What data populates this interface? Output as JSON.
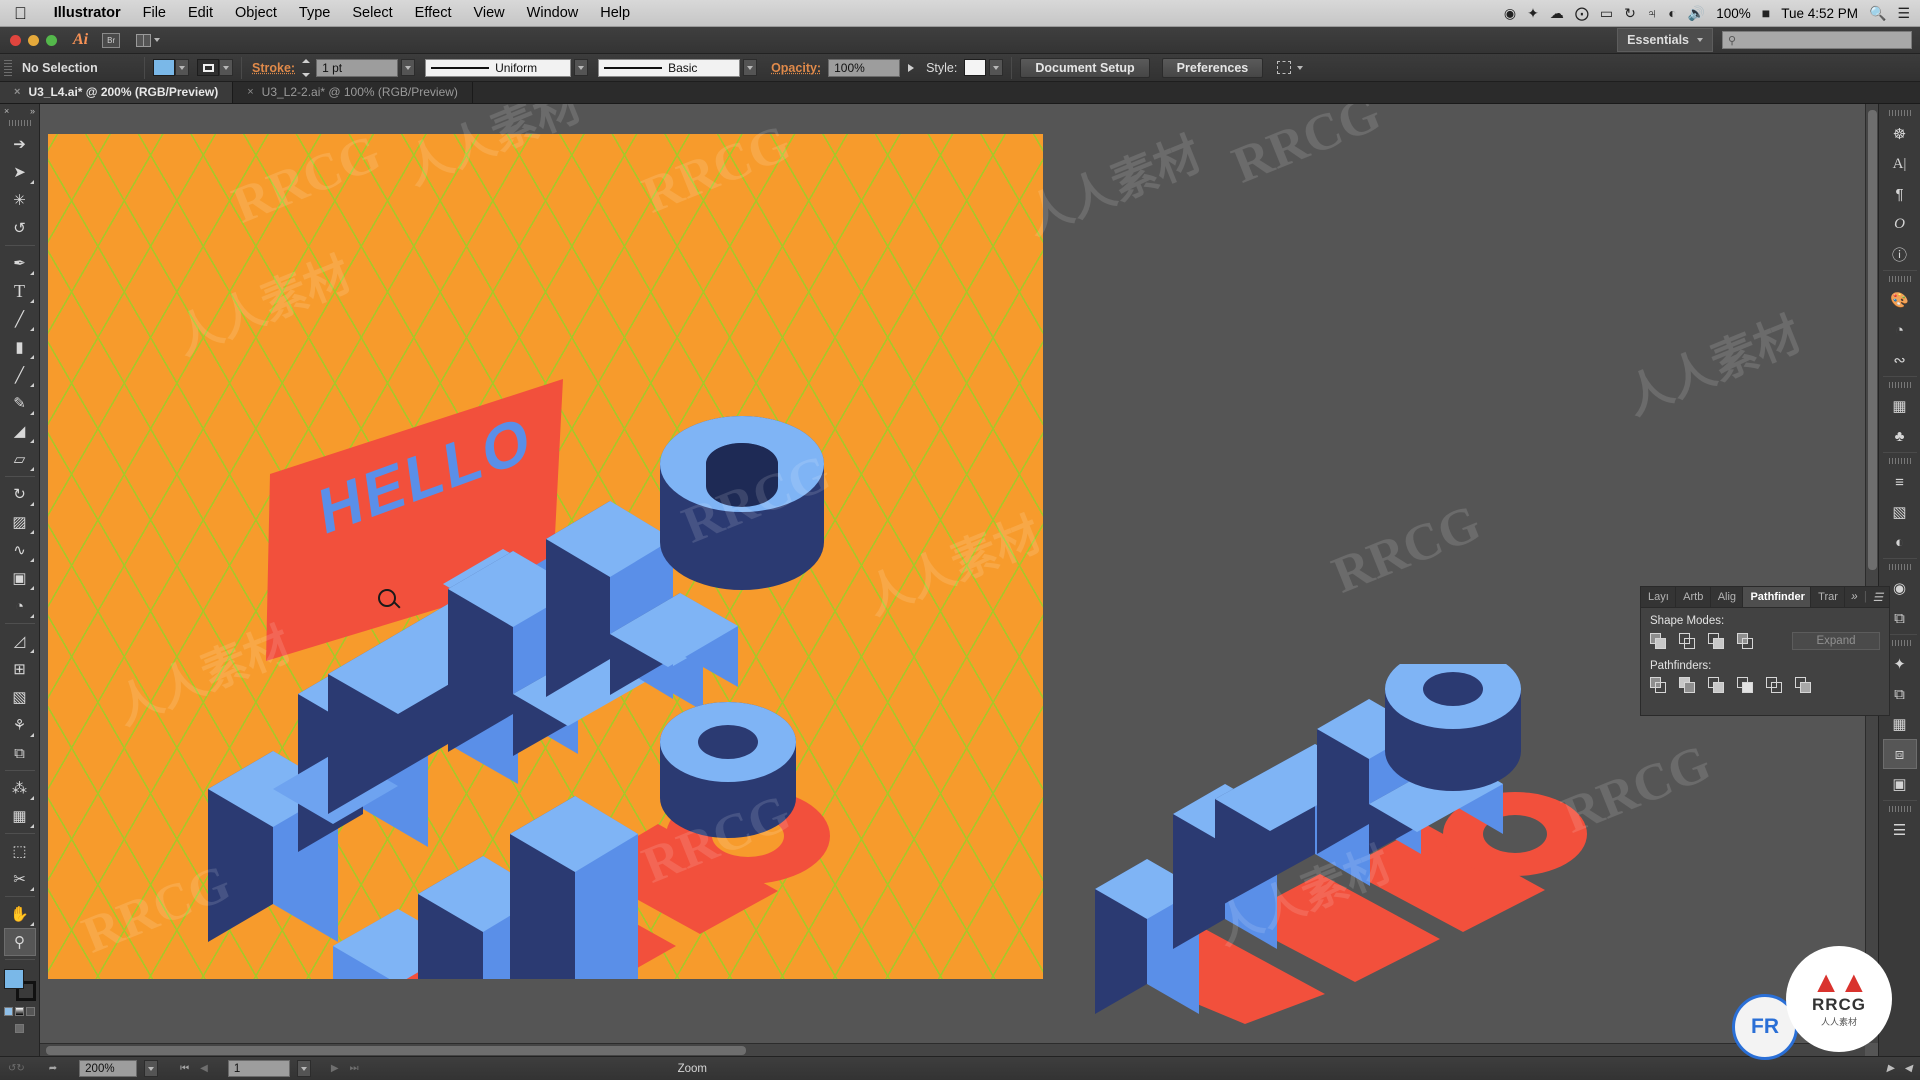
{
  "os_menu": {
    "apple_icon": "apple-icon",
    "items": [
      {
        "label": "Illustrator",
        "bold": true
      },
      {
        "label": "File",
        "bold": false
      },
      {
        "label": "Edit",
        "bold": false
      },
      {
        "label": "Object",
        "bold": false
      },
      {
        "label": "Type",
        "bold": false
      },
      {
        "label": "Select",
        "bold": false
      },
      {
        "label": "Effect",
        "bold": false
      },
      {
        "label": "View",
        "bold": false
      },
      {
        "label": "Window",
        "bold": false
      },
      {
        "label": "Help",
        "bold": false
      }
    ],
    "status_icons": [
      "screen-record-icon",
      "dropbox-icon",
      "cloud-upload-icon",
      "creative-cloud-icon",
      "airplay-icon",
      "time-machine-icon",
      "bluetooth-icon",
      "wifi-icon",
      "volume-icon"
    ],
    "battery_percent": "100%",
    "clock": "Tue 4:52 PM",
    "spotlight_icon": "search-icon",
    "control_center_icon": "list-icon"
  },
  "app_strip": {
    "app_logo": "Ai",
    "bridge_button": "Br",
    "arrange_documents_icon": "arrange-documents-icon",
    "workspace": "Essentials",
    "search_placeholder": ""
  },
  "options_bar": {
    "selection_status": "No Selection",
    "fill_color": "#7ab8e8",
    "stroke_label": "Stroke:",
    "stroke_weight": "1 pt",
    "stroke_profile": "Uniform",
    "brush_definition": "Basic",
    "opacity_label": "Opacity:",
    "opacity_value": "100%",
    "style_label": "Style:",
    "document_setup_button": "Document Setup",
    "preferences_button": "Preferences",
    "align_to_icon": "align-to-icon"
  },
  "document_tabs": [
    {
      "label": "U3_L4.ai* @ 200% (RGB/Preview)",
      "active": true
    },
    {
      "label": "U3_L2-2.ai* @ 100% (RGB/Preview)",
      "active": false
    }
  ],
  "toolbar": {
    "collapse_icon": "close-icon",
    "expand_icon": "double-chevron-right-icon",
    "tools": [
      {
        "name": "selection-tool",
        "glyph": "↖",
        "hasFlyout": false
      },
      {
        "name": "direct-selection-tool",
        "glyph": "➤",
        "hasFlyout": true
      },
      {
        "name": "magic-wand-tool",
        "glyph": "✳",
        "hasFlyout": false
      },
      {
        "name": "lasso-tool",
        "glyph": "ॐ",
        "hasFlyout": false
      },
      {
        "name": "pen-tool",
        "glyph": "✒",
        "hasFlyout": true
      },
      {
        "name": "type-tool",
        "glyph": "T",
        "hasFlyout": true
      },
      {
        "name": "line-segment-tool",
        "glyph": "╱",
        "hasFlyout": true
      },
      {
        "name": "rectangle-tool",
        "glyph": "▭",
        "hasFlyout": true
      },
      {
        "name": "paintbrush-tool",
        "glyph": "🖌",
        "hasFlyout": true
      },
      {
        "name": "pencil-tool",
        "glyph": "✎",
        "hasFlyout": true
      },
      {
        "name": "shaper-tool",
        "glyph": "◢",
        "hasFlyout": true
      },
      {
        "name": "eraser-tool",
        "glyph": "▱",
        "hasFlyout": true
      },
      {
        "name": "rotate-tool",
        "glyph": "↻",
        "hasFlyout": true
      },
      {
        "name": "scale-tool",
        "glyph": "◱",
        "hasFlyout": true
      },
      {
        "name": "width-tool",
        "glyph": "∿",
        "hasFlyout": true
      },
      {
        "name": "free-transform-tool",
        "glyph": "⌧",
        "hasFlyout": true
      },
      {
        "name": "shape-builder-tool",
        "glyph": "◔",
        "hasFlyout": true
      },
      {
        "name": "perspective-grid-tool",
        "glyph": "◳",
        "hasFlyout": true
      },
      {
        "name": "mesh-tool",
        "glyph": "⊞",
        "hasFlyout": false
      },
      {
        "name": "gradient-tool",
        "glyph": "▧",
        "hasFlyout": false
      },
      {
        "name": "eyedropper-tool",
        "glyph": "⚗",
        "hasFlyout": true
      },
      {
        "name": "blend-tool",
        "glyph": "⧉",
        "hasFlyout": false
      },
      {
        "name": "symbol-sprayer-tool",
        "glyph": "⁂",
        "hasFlyout": true
      },
      {
        "name": "column-graph-tool",
        "glyph": "Ὄa",
        "hasFlyout": true
      },
      {
        "name": "artboard-tool",
        "glyph": "⬚",
        "hasFlyout": false
      },
      {
        "name": "slice-tool",
        "glyph": "✂",
        "hasFlyout": true
      },
      {
        "name": "hand-tool",
        "glyph": "✋",
        "hasFlyout": true
      },
      {
        "name": "zoom-tool",
        "glyph": "🔍",
        "hasFlyout": false,
        "active": true
      }
    ],
    "fill_color": "#7ab8e8",
    "stroke_color": "#111111"
  },
  "pathfinder_panel": {
    "tabs": [
      {
        "label": "Layı",
        "active": false
      },
      {
        "label": "Artb",
        "active": false
      },
      {
        "label": "Alig",
        "active": false
      },
      {
        "label": "Pathfinder",
        "active": true
      },
      {
        "label": "Trar",
        "active": false
      }
    ],
    "collapse_icon": "double-chevron-right-icon",
    "menu_icon": "panel-menu-icon",
    "shape_modes_label": "Shape Modes:",
    "shape_modes": [
      "unite",
      "minus-front",
      "intersect",
      "exclude"
    ],
    "expand_button": "Expand",
    "pathfinders_label": "Pathfinders:",
    "pathfinders": [
      "divide",
      "trim",
      "merge",
      "crop",
      "outline",
      "minus-back"
    ]
  },
  "right_dock": {
    "groups": [
      [
        "color-guide-icon",
        "character-icon",
        "paragraph-icon",
        "glyphs-icon",
        "document-info-icon"
      ],
      [
        "swatches-icon",
        "gradient-icon",
        "stroke-icon"
      ],
      [
        "brushes-icon",
        "symbols-icon"
      ],
      [
        "align-icon",
        "gradient-panel-icon",
        "transparency-icon"
      ],
      [
        "appearance-icon",
        "graphic-styles-icon"
      ],
      [
        "layers-icon",
        "artboards-icon",
        "align-panel-icon",
        "pathfinder-icon",
        "transform-icon"
      ],
      [
        "libraries-icon"
      ]
    ]
  },
  "status_bar": {
    "undo_icon": "undo-icon",
    "share_icon": "share-icon",
    "zoom_level": "200%",
    "first_page_icon": "first-page-icon",
    "prev_page_icon": "prev-page-icon",
    "page_number": "1",
    "next_page_icon": "next-page-icon",
    "last_page_icon": "last-page-icon",
    "current_tool": "Zoom",
    "scroll_right_icon": "right-arrow-icon",
    "scroll_left_icon": "left-arrow-icon"
  },
  "artwork": {
    "description": "Isometric HELLO lettering illustration",
    "background_color": "#f79b2c",
    "grid_color": "#9ad028",
    "letter_face_color": "#5a8fe8",
    "letter_top_color": "#7fb4f5",
    "letter_side_color": "#2b3a72",
    "shadow_color": "#f2503c",
    "card_color": "#f2503c",
    "card_text": "HELLO",
    "main_text": "HELLO"
  },
  "watermarks": {
    "latin": "RRCG",
    "chinese": "人人素材",
    "badge_brand": "RRCG",
    "badge_sub": "人人素材",
    "badge_fr": "FR"
  }
}
